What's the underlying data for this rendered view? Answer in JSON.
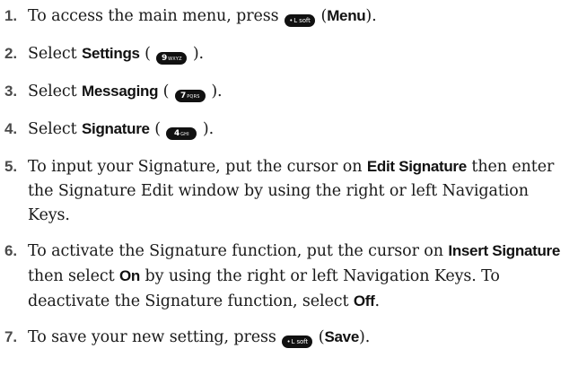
{
  "steps": [
    {
      "num": "1.",
      "t1": "To access the main menu, press",
      "key": "L soft",
      "t2": "(",
      "bold": "Menu",
      "t3": ")."
    },
    {
      "num": "2.",
      "t1": "Select",
      "bold": "Settings",
      "t2": "(",
      "key_digit": "9",
      "key_letters": "WXYZ",
      "t3": ")."
    },
    {
      "num": "3.",
      "t1": "Select",
      "bold": "Messaging",
      "t2": "(",
      "key_digit": "7",
      "key_letters": "PQRS",
      "t3": ")."
    },
    {
      "num": "4.",
      "t1": "Select",
      "bold": "Signature",
      "t2": "(",
      "key_digit": "4",
      "key_letters": "GHI",
      "t3": ")."
    },
    {
      "num": "5.",
      "t1": "To input your Signature, put the cursor on",
      "bold": "Edit Signature",
      "t2": "then enter  the Signature Edit window by using the right or left Navigation Keys."
    },
    {
      "num": "6.",
      "t1": "To activate the Signature function, put the cursor on",
      "bold": "Insert Signature",
      "t2": "then select",
      "bold2": "On",
      "t3": "by using the right or left Navigation Keys. To deactivate the Signature function, select",
      "bold3": "Off",
      "t4": "."
    },
    {
      "num": "7.",
      "t1": "To save your new setting, press",
      "key": "L soft",
      "t2": "(",
      "bold": "Save",
      "t3": ")."
    }
  ],
  "icons": {
    "soft_key": "left-softkey-icon",
    "number_key": "keypad-key-icon"
  }
}
